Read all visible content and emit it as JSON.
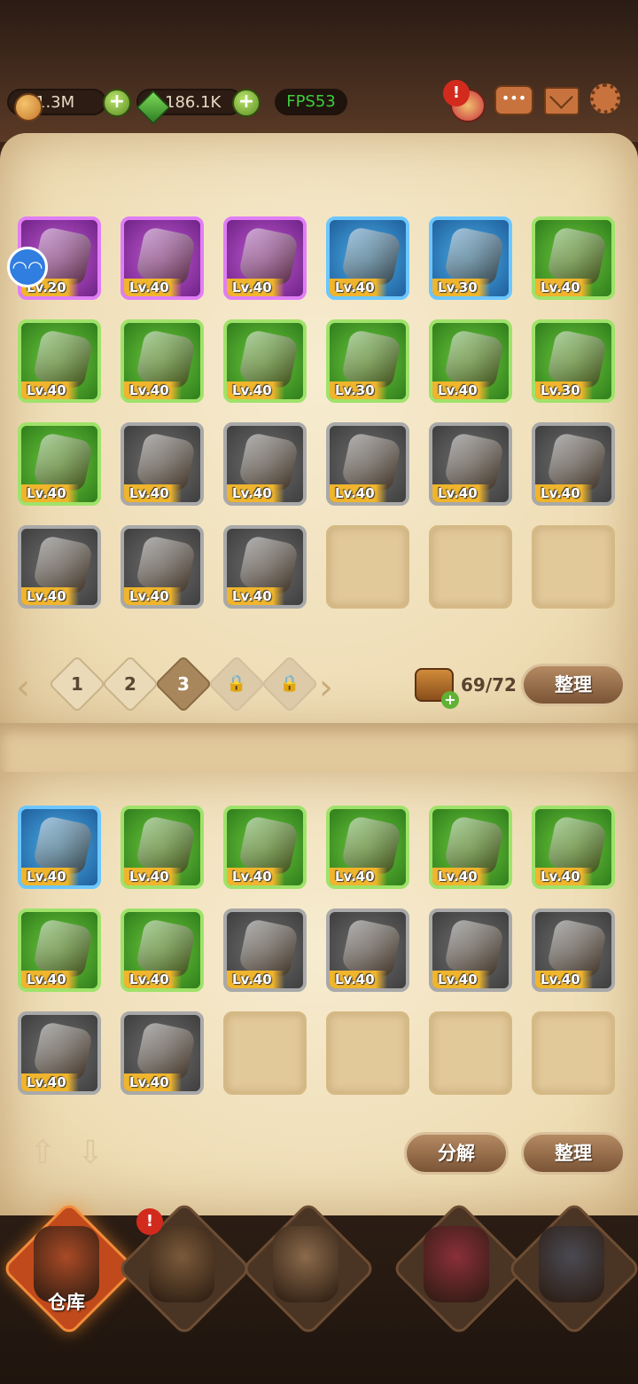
{
  "header": {
    "gold": "1.3M",
    "gems": "186.1K",
    "fps": "FPS53",
    "alert_mark": "!",
    "icons": [
      "alert-icon",
      "chat-icon",
      "mail-icon",
      "settings-icon"
    ]
  },
  "inventory_top": {
    "rows": [
      [
        {
          "rarity": "purple",
          "level": "Lv.20",
          "icon": "dagger-icon"
        },
        {
          "rarity": "purple",
          "level": "Lv.40",
          "icon": "orb-icon"
        },
        {
          "rarity": "purple",
          "level": "Lv.40",
          "icon": "hood-icon"
        },
        {
          "rarity": "blue",
          "level": "Lv.40",
          "icon": "staff-icon"
        },
        {
          "rarity": "blue",
          "level": "Lv.30",
          "icon": "chainmail-icon"
        },
        {
          "rarity": "green",
          "level": "Lv.40",
          "icon": "wand-icon"
        }
      ],
      [
        {
          "rarity": "green",
          "level": "Lv.40",
          "icon": "kunai-icon"
        },
        {
          "rarity": "green",
          "level": "Lv.40",
          "icon": "helmet-icon"
        },
        {
          "rarity": "green",
          "level": "Lv.40",
          "icon": "cloak-icon"
        },
        {
          "rarity": "green",
          "level": "Lv.30",
          "icon": "fang-necklace-icon"
        },
        {
          "rarity": "green",
          "level": "Lv.40",
          "icon": "gauntlet-icon"
        },
        {
          "rarity": "green",
          "level": "Lv.30",
          "icon": "scarf-icon"
        }
      ],
      [
        {
          "rarity": "green",
          "level": "Lv.40",
          "icon": "spiked-ring-icon"
        },
        {
          "rarity": "gray",
          "level": "Lv.40",
          "icon": "spear-icon"
        },
        {
          "rarity": "gray",
          "level": "Lv.40",
          "icon": "shield-icon"
        },
        {
          "rarity": "gray",
          "level": "Lv.40",
          "icon": "amulet-icon"
        },
        {
          "rarity": "gray",
          "level": "Lv.40",
          "icon": "robe-icon"
        },
        {
          "rarity": "gray",
          "level": "Lv.40",
          "icon": "armor-icon"
        }
      ],
      [
        {
          "rarity": "gray",
          "level": "Lv.40",
          "icon": "boot-icon"
        },
        {
          "rarity": "gray",
          "level": "Lv.40",
          "icon": "ring-icon"
        },
        {
          "rarity": "gray",
          "level": "Lv.40",
          "icon": "fur-boot-icon"
        },
        {
          "rarity": "empty",
          "level": "",
          "icon": ""
        },
        {
          "rarity": "empty",
          "level": "",
          "icon": ""
        },
        {
          "rarity": "empty",
          "level": "",
          "icon": ""
        }
      ]
    ],
    "pages": [
      "1",
      "2",
      "3"
    ],
    "active_page": "3",
    "locked_pages": 2,
    "capacity": "69/72",
    "sort_label": "整理"
  },
  "inventory_bottom": {
    "rows": [
      [
        {
          "rarity": "blue",
          "level": "Lv.40",
          "icon": "gauntlet-icon"
        },
        {
          "rarity": "green",
          "level": "Lv.40",
          "icon": "feather-hat-icon"
        },
        {
          "rarity": "green",
          "level": "Lv.40",
          "icon": "feather-hat-icon"
        },
        {
          "rarity": "green",
          "level": "Lv.40",
          "icon": "chainmail-icon"
        },
        {
          "rarity": "green",
          "level": "Lv.40",
          "icon": "plate-gauntlet-icon"
        },
        {
          "rarity": "green",
          "level": "Lv.40",
          "icon": "spiked-ring-icon"
        }
      ],
      [
        {
          "rarity": "green",
          "level": "Lv.40",
          "icon": "gold-ring-icon"
        },
        {
          "rarity": "green",
          "level": "Lv.40",
          "icon": "gold-boot-icon"
        },
        {
          "rarity": "gray",
          "level": "Lv.40",
          "icon": "scimitar-icon"
        },
        {
          "rarity": "gray",
          "level": "Lv.40",
          "icon": "wooden-shield-icon"
        },
        {
          "rarity": "gray",
          "level": "Lv.40",
          "icon": "shuriken-icon"
        },
        {
          "rarity": "gray",
          "level": "Lv.40",
          "icon": "blue-robe-icon"
        }
      ],
      [
        {
          "rarity": "gray",
          "level": "Lv.40",
          "icon": "dark-ring-icon"
        },
        {
          "rarity": "gray",
          "level": "Lv.40",
          "icon": "skull-ring-icon"
        },
        {
          "rarity": "empty",
          "level": "",
          "icon": ""
        },
        {
          "rarity": "empty",
          "level": "",
          "icon": ""
        },
        {
          "rarity": "empty",
          "level": "",
          "icon": ""
        },
        {
          "rarity": "empty",
          "level": "",
          "icon": ""
        }
      ]
    ],
    "decompose_label": "分解",
    "sort_label": "整理"
  },
  "nav": {
    "items": [
      {
        "name": "warehouse",
        "label": "仓库",
        "active": true
      },
      {
        "name": "tavern",
        "label": "",
        "alert": true
      },
      {
        "name": "portal",
        "label": ""
      },
      {
        "name": "armory",
        "label": ""
      },
      {
        "name": "forge",
        "label": ""
      }
    ]
  },
  "colors": {
    "purple": "#c45ad6",
    "blue": "#4ab0ea",
    "green": "#6ecc3c",
    "gray": "#707070",
    "accent": "#3ccd3a"
  }
}
